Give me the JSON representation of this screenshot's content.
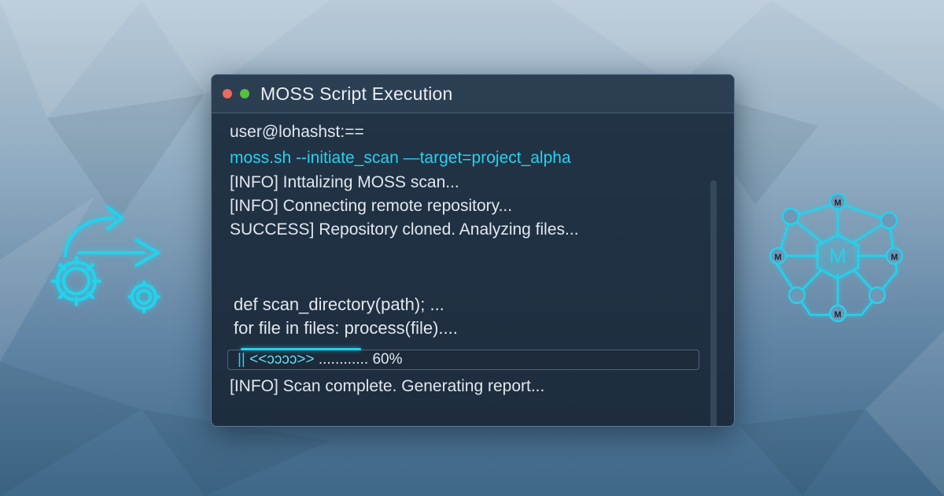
{
  "window": {
    "title": "MOSS Script Execution",
    "buttons": [
      "close",
      "zoom"
    ]
  },
  "terminal": {
    "lines": [
      "user@lohashst:==",
      "moss.sh --initiate_scan —target=project_alpha",
      "[INFO] Inttalizing MOSS scan...",
      "[INFO] Connecting remote repository...",
      "SUCCESS] Repository cloned. Analyzing files..."
    ],
    "code": [
      "def scan_directory(path); ...",
      "for file in files: process(file)...."
    ],
    "progress": {
      "bars": "||",
      "arrows": "<<ᴐᴐᴐᴐ>>",
      "dots": "............",
      "percent_label": "60%",
      "value": 0.6
    },
    "final_line": "[INFO] Scan complete. Generating report..."
  },
  "graphics": {
    "network_center_label": "M",
    "network_node_label": "M"
  },
  "colors": {
    "accent": "#22d3ee",
    "terminal_bg": "#223244",
    "text": "#e1e7ee"
  }
}
